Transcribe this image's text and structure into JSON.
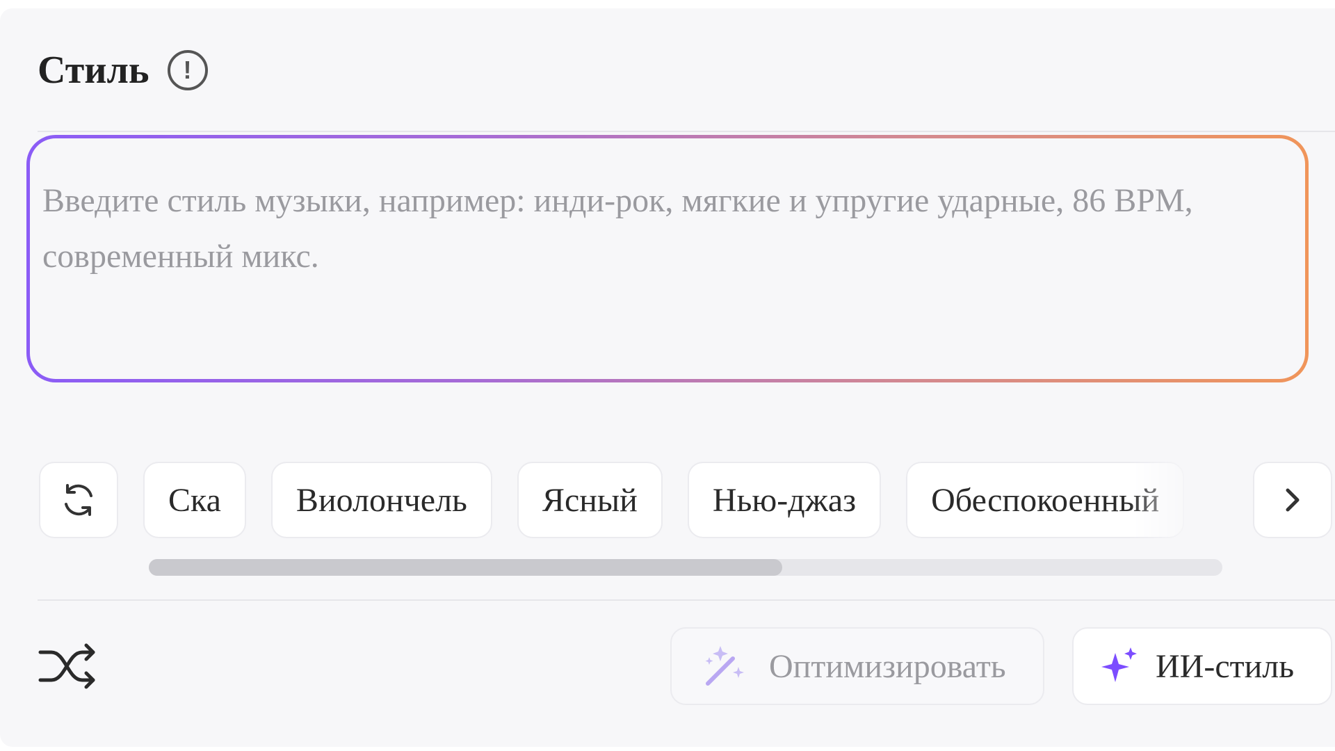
{
  "style_section": {
    "title": "Стиль",
    "info_icon": "info-icon",
    "input": {
      "value": "",
      "placeholder": "Введите стиль музыки, например: инди-рок, мягкие и упругие ударные, 86 BPM, современный микс."
    },
    "input_border_gradient": [
      "#8b5cf6",
      "#f0955a"
    ]
  },
  "tags": {
    "refresh_icon": "refresh-icon",
    "items": [
      "Ска",
      "Виолончель",
      "Ясный",
      "Нью-джаз",
      "Обеспокоенный"
    ],
    "next_icon": "chevron-right-icon",
    "scroll_fraction_visible": 0.59
  },
  "actions": {
    "shuffle_icon": "shuffle-icon",
    "optimize_label": "Оптимизировать",
    "optimize_icon": "magic-wand-icon",
    "ai_style_label": "ИИ-стиль",
    "ai_style_icon": "sparkle-icon",
    "accent_color": "#8b5cf6"
  }
}
